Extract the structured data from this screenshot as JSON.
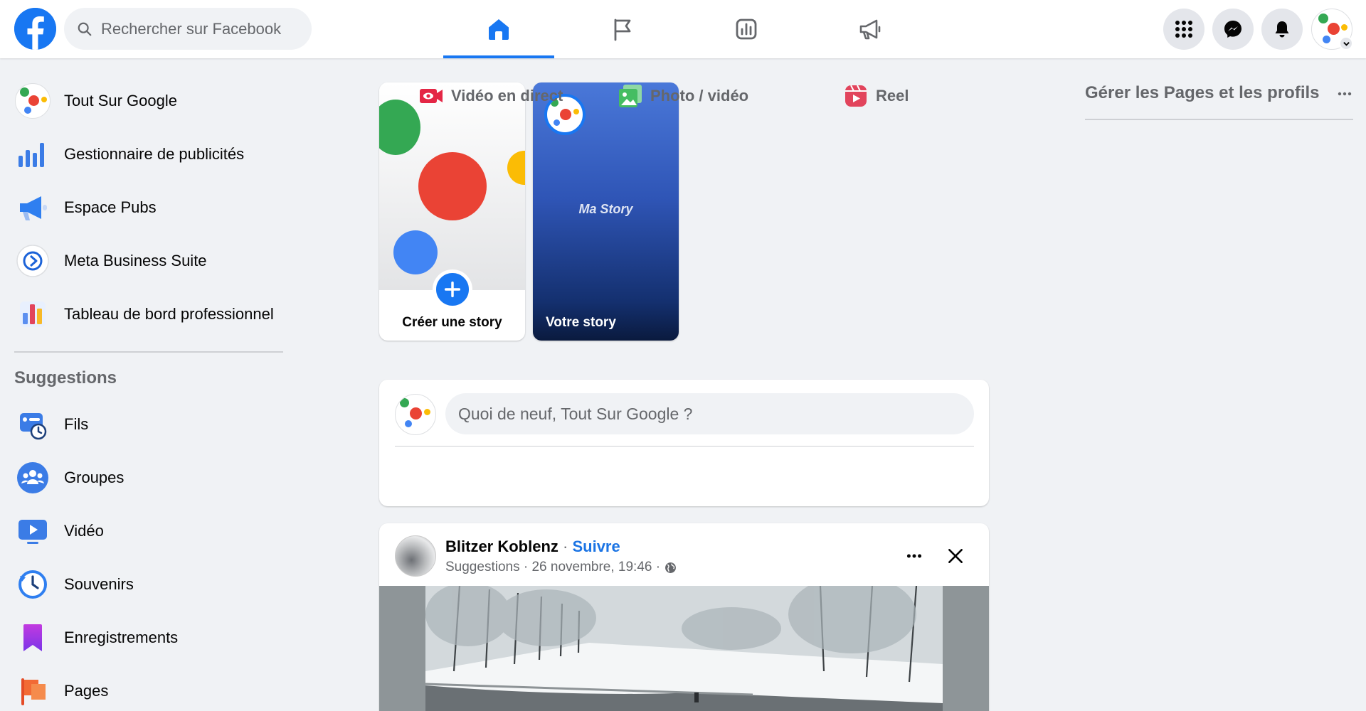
{
  "brand": {
    "accent": "#1877f2",
    "follow_link": "#1b74e4"
  },
  "topbar": {
    "search": {
      "placeholder": "Rechercher sur Facebook",
      "icon": "search-icon"
    },
    "tabs": [
      {
        "name": "home",
        "icon": "home-icon",
        "active": true
      },
      {
        "name": "pages",
        "icon": "flag-icon",
        "active": false
      },
      {
        "name": "insights",
        "icon": "chart-icon",
        "active": false
      },
      {
        "name": "ads",
        "icon": "megaphone-icon",
        "active": false
      }
    ],
    "actions": [
      "grid-menu-icon",
      "messenger-icon",
      "bell-icon",
      "profile-avatar"
    ]
  },
  "sidebar": {
    "items": [
      {
        "label": "Tout Sur Google",
        "icon": "profile-avatar"
      },
      {
        "label": "Gestionnaire de publicités",
        "icon": "ads-manager-icon"
      },
      {
        "label": "Espace Pubs",
        "icon": "megaphone-icon"
      },
      {
        "label": "Meta Business Suite",
        "icon": "business-suite-icon"
      },
      {
        "label": "Tableau de bord professionnel",
        "icon": "dashboard-icon"
      }
    ],
    "suggestions_title": "Suggestions",
    "suggestions": [
      {
        "label": "Fils",
        "icon": "feeds-icon"
      },
      {
        "label": "Groupes",
        "icon": "groups-icon"
      },
      {
        "label": "Vidéo",
        "icon": "video-icon"
      },
      {
        "label": "Souvenirs",
        "icon": "memories-icon"
      },
      {
        "label": "Enregistrements",
        "icon": "saved-icon"
      },
      {
        "label": "Pages",
        "icon": "pages-icon"
      }
    ]
  },
  "stories": {
    "create_label": "Créer une story",
    "mine_label": "Votre story",
    "mine_text": "Ma Story"
  },
  "composer": {
    "placeholder": "Quoi de neuf, Tout Sur Google ?",
    "actions": [
      {
        "label": "Vidéo en direct",
        "icon": "live-video-icon",
        "color": "#e42645"
      },
      {
        "label": "Photo / vidéo",
        "icon": "photo-icon",
        "color": "#45bd62"
      },
      {
        "label": "Reel",
        "icon": "reel-icon",
        "color": "#e2445c"
      }
    ]
  },
  "post": {
    "author": "Blitzer Koblenz",
    "separator": " · ",
    "follow": "Suivre",
    "meta": "Suggestions · 26 novembre, 19:46 ·",
    "privacy_icon": "globe-icon"
  },
  "right": {
    "title": "Gérer les Pages et les profils"
  }
}
